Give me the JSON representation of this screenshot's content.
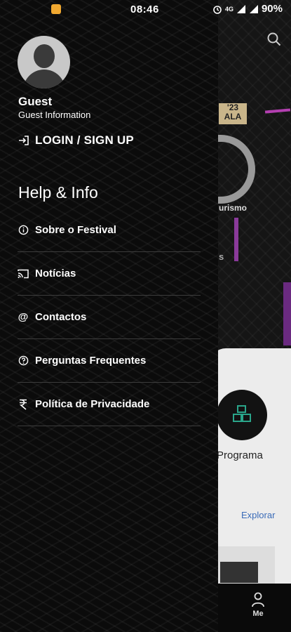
{
  "status_bar": {
    "time": "08:46",
    "network": "4G",
    "battery": "90%"
  },
  "background": {
    "badge_top": "'23",
    "badge_bottom": "ALA",
    "brand_text": "urismo",
    "fragment_letter": "s",
    "programa_label": "Programa",
    "explorar_link": "Explorar",
    "bottom_nav_me": "Me"
  },
  "drawer": {
    "user_name": "Guest",
    "user_subtitle": "Guest Information",
    "login_label": "LOGIN / SIGN UP",
    "section_title": "Help & Info",
    "menu": [
      {
        "label": "Sobre o Festival",
        "icon": "info-icon"
      },
      {
        "label": "Notícias",
        "icon": "cast-icon"
      },
      {
        "label": "Contactos",
        "icon": "at-icon"
      },
      {
        "label": "Perguntas Frequentes",
        "icon": "help-icon"
      },
      {
        "label": "Política de Privacidade",
        "icon": "policy-icon"
      }
    ]
  }
}
